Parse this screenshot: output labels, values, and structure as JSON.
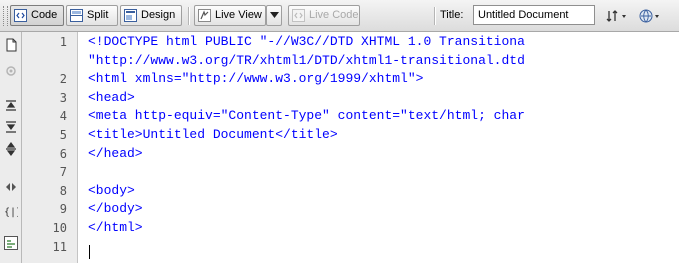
{
  "toolbar": {
    "code_label": "Code",
    "split_label": "Split",
    "design_label": "Design",
    "liveview_label": "Live View",
    "livecode_label": "Live Code",
    "title_label": "Title:",
    "title_value": "Untitled Document",
    "icons": [
      "code-view-icon",
      "split-view-icon",
      "design-view-icon",
      "live-view-icon",
      "live-view-dropdown-icon",
      "live-code-icon",
      "file-management-icon",
      "preview-browser-icon"
    ]
  },
  "sidebar": {
    "icons": [
      "open-documents-icon",
      "show-code-navigator-icon",
      "collapse-full-tag-icon",
      "collapse-selection-icon",
      "expand-all-icon",
      "select-parent-tag-icon",
      "balance-braces-icon",
      "format-source-code-icon"
    ]
  },
  "editor": {
    "lines": [
      {
        "no": "1",
        "text": "<!DOCTYPE html PUBLIC \"-//W3C//DTD XHTML 1.0 Transitiona"
      },
      {
        "no": "",
        "text": "\"http://www.w3.org/TR/xhtml1/DTD/xhtml1-transitional.dtd"
      },
      {
        "no": "2",
        "text": "<html xmlns=\"http://www.w3.org/1999/xhtml\">"
      },
      {
        "no": "3",
        "text": "<head>"
      },
      {
        "no": "4",
        "text": "<meta http-equiv=\"Content-Type\" content=\"text/html; char"
      },
      {
        "no": "5",
        "text": "<title>Untitled Document</title>"
      },
      {
        "no": "6",
        "text": "</head>"
      },
      {
        "no": "7",
        "text": ""
      },
      {
        "no": "8",
        "text": "<body>"
      },
      {
        "no": "9",
        "text": "</body>"
      },
      {
        "no": "10",
        "text": "</html>"
      },
      {
        "no": "11",
        "text": ""
      }
    ],
    "code_color": "#0000ff"
  }
}
